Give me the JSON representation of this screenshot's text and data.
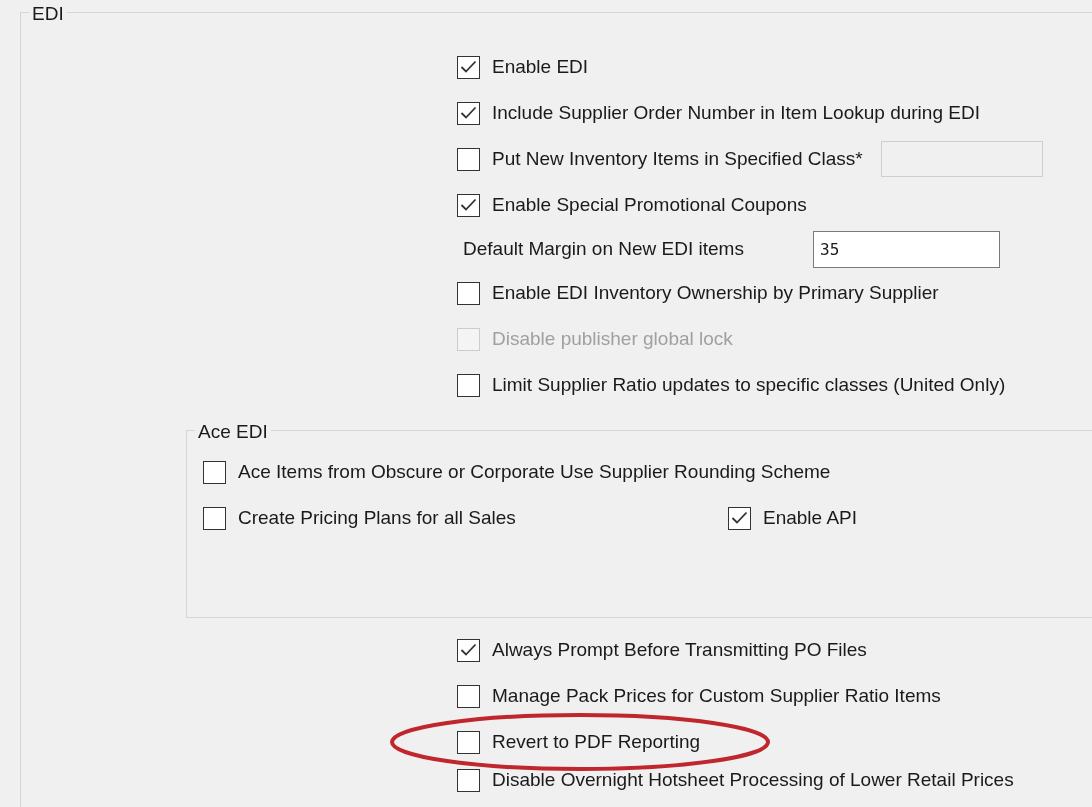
{
  "edi": {
    "title": "EDI",
    "options": [
      {
        "kind": "checkbox",
        "label": "Enable EDI",
        "checked": true,
        "disabled": false
      },
      {
        "kind": "checkbox",
        "label": "Include Supplier Order Number in Item Lookup during EDI",
        "checked": true,
        "disabled": false
      },
      {
        "kind": "checkbox_with_field",
        "label": "Put New Inventory Items in Specified Class*",
        "checked": false,
        "disabled": false
      },
      {
        "kind": "checkbox",
        "label": "Enable Special Promotional Coupons",
        "checked": true,
        "disabled": false
      },
      {
        "kind": "number",
        "label": "Default Margin on New EDI items",
        "value": "35"
      },
      {
        "kind": "checkbox",
        "label": "Enable EDI Inventory Ownership by Primary Supplier",
        "checked": false,
        "disabled": false
      },
      {
        "kind": "checkbox",
        "label": "Disable publisher global lock",
        "checked": false,
        "disabled": true
      },
      {
        "kind": "checkbox",
        "label": "Limit Supplier Ratio updates to specific classes (United Only)",
        "checked": false,
        "disabled": false
      }
    ],
    "ace_edi": {
      "title": "Ace EDI",
      "rows": [
        [
          {
            "label": "Ace Items from Obscure or Corporate Use Supplier Rounding Scheme",
            "checked": false
          }
        ],
        [
          {
            "label": "Create Pricing Plans for all Sales",
            "checked": false
          },
          {
            "label": "Enable API",
            "checked": true
          }
        ]
      ]
    },
    "more_options": [
      {
        "label": "Always Prompt Before Transmitting PO Files",
        "checked": true,
        "circled": false
      },
      {
        "label": "Manage Pack Prices for Custom Supplier Ratio Items",
        "checked": false,
        "circled": false
      },
      {
        "label": "Revert to PDF Reporting",
        "checked": false,
        "circled": true
      },
      {
        "label": "Disable Overnight Hotsheet Processing of Lower Retail Prices",
        "checked": false,
        "circled": false
      }
    ]
  }
}
